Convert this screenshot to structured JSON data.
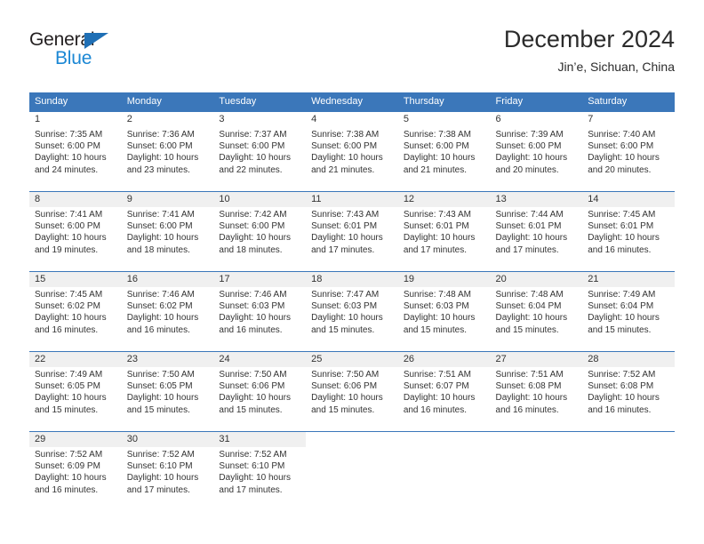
{
  "brand": {
    "name_part1": "General",
    "name_part2": "Blue",
    "accent_color": "#1b87d4",
    "triangle_color": "#1f6fb5"
  },
  "header": {
    "title": "December 2024",
    "subtitle": "Jin’e, Sichuan, China"
  },
  "calendar": {
    "header_bg": "#3b77ba",
    "weekday_headers": [
      "Sunday",
      "Monday",
      "Tuesday",
      "Wednesday",
      "Thursday",
      "Friday",
      "Saturday"
    ],
    "weeks": [
      {
        "shaded": false,
        "days": [
          {
            "num": "1",
            "sunrise": "Sunrise: 7:35 AM",
            "sunset": "Sunset: 6:00 PM",
            "daylight1": "Daylight: 10 hours",
            "daylight2": "and 24 minutes."
          },
          {
            "num": "2",
            "sunrise": "Sunrise: 7:36 AM",
            "sunset": "Sunset: 6:00 PM",
            "daylight1": "Daylight: 10 hours",
            "daylight2": "and 23 minutes."
          },
          {
            "num": "3",
            "sunrise": "Sunrise: 7:37 AM",
            "sunset": "Sunset: 6:00 PM",
            "daylight1": "Daylight: 10 hours",
            "daylight2": "and 22 minutes."
          },
          {
            "num": "4",
            "sunrise": "Sunrise: 7:38 AM",
            "sunset": "Sunset: 6:00 PM",
            "daylight1": "Daylight: 10 hours",
            "daylight2": "and 21 minutes."
          },
          {
            "num": "5",
            "sunrise": "Sunrise: 7:38 AM",
            "sunset": "Sunset: 6:00 PM",
            "daylight1": "Daylight: 10 hours",
            "daylight2": "and 21 minutes."
          },
          {
            "num": "6",
            "sunrise": "Sunrise: 7:39 AM",
            "sunset": "Sunset: 6:00 PM",
            "daylight1": "Daylight: 10 hours",
            "daylight2": "and 20 minutes."
          },
          {
            "num": "7",
            "sunrise": "Sunrise: 7:40 AM",
            "sunset": "Sunset: 6:00 PM",
            "daylight1": "Daylight: 10 hours",
            "daylight2": "and 20 minutes."
          }
        ]
      },
      {
        "shaded": true,
        "days": [
          {
            "num": "8",
            "sunrise": "Sunrise: 7:41 AM",
            "sunset": "Sunset: 6:00 PM",
            "daylight1": "Daylight: 10 hours",
            "daylight2": "and 19 minutes."
          },
          {
            "num": "9",
            "sunrise": "Sunrise: 7:41 AM",
            "sunset": "Sunset: 6:00 PM",
            "daylight1": "Daylight: 10 hours",
            "daylight2": "and 18 minutes."
          },
          {
            "num": "10",
            "sunrise": "Sunrise: 7:42 AM",
            "sunset": "Sunset: 6:00 PM",
            "daylight1": "Daylight: 10 hours",
            "daylight2": "and 18 minutes."
          },
          {
            "num": "11",
            "sunrise": "Sunrise: 7:43 AM",
            "sunset": "Sunset: 6:01 PM",
            "daylight1": "Daylight: 10 hours",
            "daylight2": "and 17 minutes."
          },
          {
            "num": "12",
            "sunrise": "Sunrise: 7:43 AM",
            "sunset": "Sunset: 6:01 PM",
            "daylight1": "Daylight: 10 hours",
            "daylight2": "and 17 minutes."
          },
          {
            "num": "13",
            "sunrise": "Sunrise: 7:44 AM",
            "sunset": "Sunset: 6:01 PM",
            "daylight1": "Daylight: 10 hours",
            "daylight2": "and 17 minutes."
          },
          {
            "num": "14",
            "sunrise": "Sunrise: 7:45 AM",
            "sunset": "Sunset: 6:01 PM",
            "daylight1": "Daylight: 10 hours",
            "daylight2": "and 16 minutes."
          }
        ]
      },
      {
        "shaded": true,
        "days": [
          {
            "num": "15",
            "sunrise": "Sunrise: 7:45 AM",
            "sunset": "Sunset: 6:02 PM",
            "daylight1": "Daylight: 10 hours",
            "daylight2": "and 16 minutes."
          },
          {
            "num": "16",
            "sunrise": "Sunrise: 7:46 AM",
            "sunset": "Sunset: 6:02 PM",
            "daylight1": "Daylight: 10 hours",
            "daylight2": "and 16 minutes."
          },
          {
            "num": "17",
            "sunrise": "Sunrise: 7:46 AM",
            "sunset": "Sunset: 6:03 PM",
            "daylight1": "Daylight: 10 hours",
            "daylight2": "and 16 minutes."
          },
          {
            "num": "18",
            "sunrise": "Sunrise: 7:47 AM",
            "sunset": "Sunset: 6:03 PM",
            "daylight1": "Daylight: 10 hours",
            "daylight2": "and 15 minutes."
          },
          {
            "num": "19",
            "sunrise": "Sunrise: 7:48 AM",
            "sunset": "Sunset: 6:03 PM",
            "daylight1": "Daylight: 10 hours",
            "daylight2": "and 15 minutes."
          },
          {
            "num": "20",
            "sunrise": "Sunrise: 7:48 AM",
            "sunset": "Sunset: 6:04 PM",
            "daylight1": "Daylight: 10 hours",
            "daylight2": "and 15 minutes."
          },
          {
            "num": "21",
            "sunrise": "Sunrise: 7:49 AM",
            "sunset": "Sunset: 6:04 PM",
            "daylight1": "Daylight: 10 hours",
            "daylight2": "and 15 minutes."
          }
        ]
      },
      {
        "shaded": true,
        "days": [
          {
            "num": "22",
            "sunrise": "Sunrise: 7:49 AM",
            "sunset": "Sunset: 6:05 PM",
            "daylight1": "Daylight: 10 hours",
            "daylight2": "and 15 minutes."
          },
          {
            "num": "23",
            "sunrise": "Sunrise: 7:50 AM",
            "sunset": "Sunset: 6:05 PM",
            "daylight1": "Daylight: 10 hours",
            "daylight2": "and 15 minutes."
          },
          {
            "num": "24",
            "sunrise": "Sunrise: 7:50 AM",
            "sunset": "Sunset: 6:06 PM",
            "daylight1": "Daylight: 10 hours",
            "daylight2": "and 15 minutes."
          },
          {
            "num": "25",
            "sunrise": "Sunrise: 7:50 AM",
            "sunset": "Sunset: 6:06 PM",
            "daylight1": "Daylight: 10 hours",
            "daylight2": "and 15 minutes."
          },
          {
            "num": "26",
            "sunrise": "Sunrise: 7:51 AM",
            "sunset": "Sunset: 6:07 PM",
            "daylight1": "Daylight: 10 hours",
            "daylight2": "and 16 minutes."
          },
          {
            "num": "27",
            "sunrise": "Sunrise: 7:51 AM",
            "sunset": "Sunset: 6:08 PM",
            "daylight1": "Daylight: 10 hours",
            "daylight2": "and 16 minutes."
          },
          {
            "num": "28",
            "sunrise": "Sunrise: 7:52 AM",
            "sunset": "Sunset: 6:08 PM",
            "daylight1": "Daylight: 10 hours",
            "daylight2": "and 16 minutes."
          }
        ]
      },
      {
        "shaded": true,
        "days": [
          {
            "num": "29",
            "sunrise": "Sunrise: 7:52 AM",
            "sunset": "Sunset: 6:09 PM",
            "daylight1": "Daylight: 10 hours",
            "daylight2": "and 16 minutes."
          },
          {
            "num": "30",
            "sunrise": "Sunrise: 7:52 AM",
            "sunset": "Sunset: 6:10 PM",
            "daylight1": "Daylight: 10 hours",
            "daylight2": "and 17 minutes."
          },
          {
            "num": "31",
            "sunrise": "Sunrise: 7:52 AM",
            "sunset": "Sunset: 6:10 PM",
            "daylight1": "Daylight: 10 hours",
            "daylight2": "and 17 minutes."
          },
          {
            "num": "",
            "sunrise": "",
            "sunset": "",
            "daylight1": "",
            "daylight2": ""
          },
          {
            "num": "",
            "sunrise": "",
            "sunset": "",
            "daylight1": "",
            "daylight2": ""
          },
          {
            "num": "",
            "sunrise": "",
            "sunset": "",
            "daylight1": "",
            "daylight2": ""
          },
          {
            "num": "",
            "sunrise": "",
            "sunset": "",
            "daylight1": "",
            "daylight2": ""
          }
        ]
      }
    ]
  }
}
